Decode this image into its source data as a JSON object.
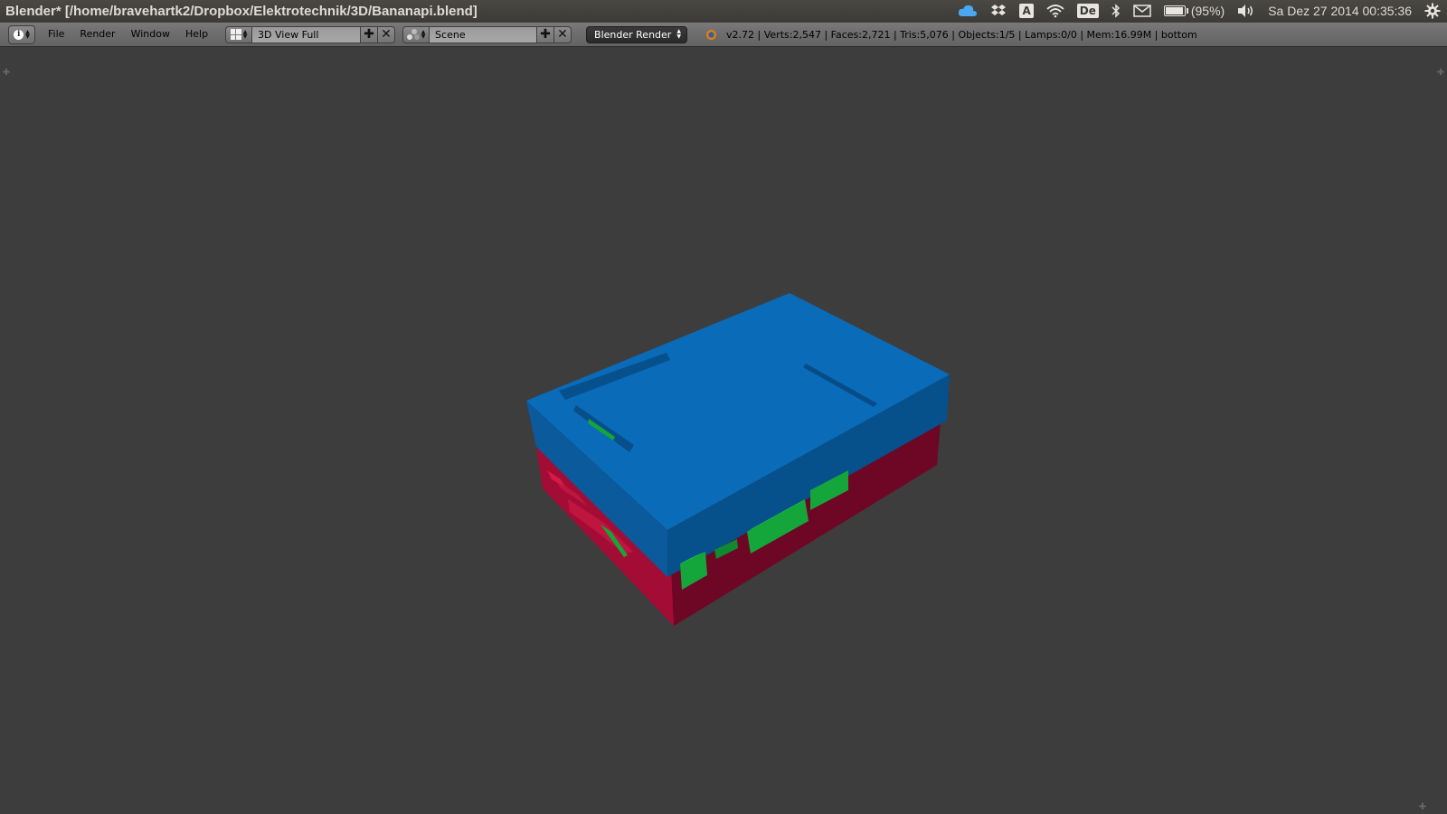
{
  "window": {
    "title": "Blender* [/home/bravehartk2/Dropbox/Elektrotechnik/3D/Bananapi.blend]"
  },
  "tray": {
    "keyboard_letter": "A",
    "language": "De",
    "battery_text": "(95%)",
    "battery_level": 0.95,
    "clock": "Sa Dez 27 2014 00:35:36",
    "icons": [
      "cloud-icon",
      "dropbox-icon",
      "keyboard-icon",
      "wifi-icon",
      "language-icon",
      "bluetooth-icon",
      "mail-icon",
      "battery-icon",
      "volume-icon",
      "gear-icon"
    ]
  },
  "header": {
    "editor_icon": "info-icon",
    "menu": [
      "File",
      "Render",
      "Window",
      "Help"
    ],
    "screen_layout": "3D View Full",
    "scene": "Scene",
    "render_engine": "Blender Render",
    "stats": "v2.72 | Verts:2,547 | Faces:2,721 | Tris:5,076 | Objects:1/5 | Lamps:0/0 | Mem:16.99M | bottom"
  },
  "viewport": {
    "background": "#3d3d3d",
    "object": "banana-pi-case-model",
    "colors": {
      "lid": "#0a6bb8",
      "base": "#a30d35",
      "board": "#14a63a"
    }
  }
}
